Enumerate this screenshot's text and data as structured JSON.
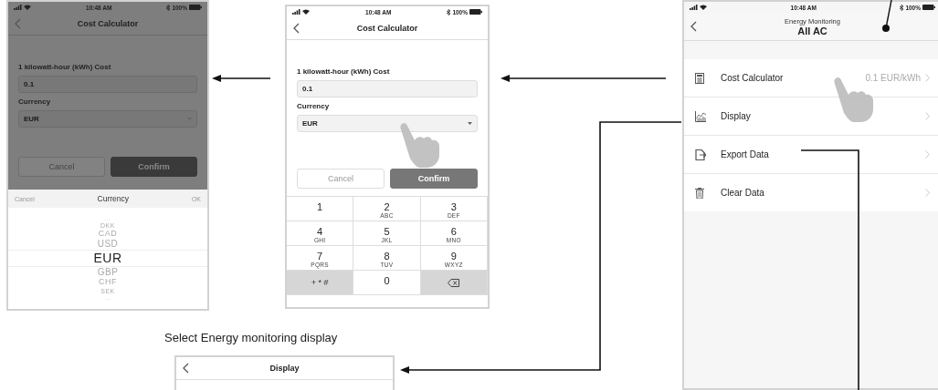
{
  "screen_currency_picker": {
    "dimmed": true,
    "status": {
      "time": "10:48 AM",
      "battery": "100%"
    },
    "title": "Cost Calculator",
    "cost_label": "1 kilowatt-hour (kWh) Cost",
    "cost_value": "0.1",
    "currency_label": "Currency",
    "currency_value": "EUR",
    "buttons": [
      {
        "label": "Cancel",
        "kind": "secondary"
      },
      {
        "label": "Confirm",
        "kind": "primary"
      }
    ],
    "picker": {
      "cancel": "Cancel",
      "title": "Currency",
      "ok": "OK",
      "items": [
        {
          "label": "...",
          "selected": false
        },
        {
          "label": "DKK",
          "selected": false
        },
        {
          "label": "CAD",
          "selected": false
        },
        {
          "label": "USD",
          "selected": false
        },
        {
          "label": "EUR",
          "selected": true
        },
        {
          "label": "GBP",
          "selected": false
        },
        {
          "label": "CHF",
          "selected": false
        },
        {
          "label": "SEK",
          "selected": false
        },
        {
          "label": "...",
          "selected": false
        }
      ]
    }
  },
  "screen_cost_calculator": {
    "dimmed": false,
    "status": {
      "time": "10:48 AM",
      "battery": "100%"
    },
    "title": "Cost Calculator",
    "cost_label": "1 kilowatt-hour (kWh) Cost",
    "cost_value": "0.1",
    "currency_label": "Currency",
    "currency_value": "EUR",
    "buttons": [
      {
        "label": "Cancel",
        "kind": "secondary"
      },
      {
        "label": "Confirm",
        "kind": "primary"
      }
    ],
    "keypad": [
      {
        "kind": "digit",
        "digit": "1"
      },
      {
        "kind": "digit",
        "digit": "2",
        "letters": "ABC"
      },
      {
        "kind": "digit",
        "digit": "3",
        "letters": "DEF"
      },
      {
        "kind": "digit",
        "digit": "4",
        "letters": "GHI"
      },
      {
        "kind": "digit",
        "digit": "5",
        "letters": "JKL"
      },
      {
        "kind": "digit",
        "digit": "6",
        "letters": "MNO"
      },
      {
        "kind": "digit",
        "digit": "7",
        "letters": "PQRS"
      },
      {
        "kind": "digit",
        "digit": "8",
        "letters": "TUV"
      },
      {
        "kind": "digit",
        "digit": "9",
        "letters": "WXYZ"
      },
      {
        "kind": "symbols",
        "digit": "+ * #"
      },
      {
        "kind": "digit",
        "digit": "0"
      },
      {
        "kind": "backspace"
      }
    ]
  },
  "screen_energy_monitoring": {
    "status": {
      "time": "10:48 AM",
      "battery": "100%"
    },
    "subtitle": "Energy Monitoring",
    "title": "All AC",
    "menu": [
      {
        "kind": "calculator",
        "label": "Cost Calculator",
        "value": "0.1 EUR/kWh"
      },
      {
        "kind": "chart",
        "label": "Display"
      },
      {
        "kind": "export",
        "label": "Export Data"
      },
      {
        "kind": "trash",
        "label": "Clear Data"
      }
    ]
  },
  "caption": "Select Energy monitoring display",
  "screen_display": {
    "title": "Display"
  }
}
